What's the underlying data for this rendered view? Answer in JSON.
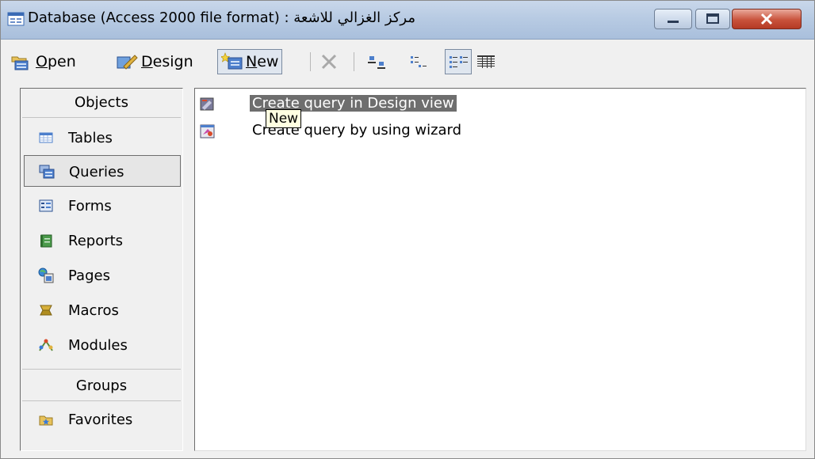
{
  "window": {
    "title": "مركز الغزالي للاشعة : Database (Access 2000 file format)",
    "accent": "#b8cbe3",
    "close_color": "#c9523b"
  },
  "toolbar": {
    "open_label": "Open",
    "open_mnemonic": "O",
    "design_label": "Design",
    "design_mnemonic": "D",
    "new_label": "New",
    "new_mnemonic": "N",
    "icons": [
      "open-icon",
      "design-icon",
      "new-icon",
      "delete-icon",
      "large-icons-view-icon",
      "small-icons-view-icon",
      "list-view-icon",
      "details-view-icon"
    ]
  },
  "sidebar": {
    "objects_header": "Objects",
    "groups_header": "Groups",
    "items": [
      {
        "label": "Tables",
        "icon": "table-icon"
      },
      {
        "label": "Queries",
        "icon": "query-icon"
      },
      {
        "label": "Forms",
        "icon": "form-icon"
      },
      {
        "label": "Reports",
        "icon": "report-icon"
      },
      {
        "label": "Pages",
        "icon": "page-icon"
      },
      {
        "label": "Macros",
        "icon": "macro-icon"
      },
      {
        "label": "Modules",
        "icon": "module-icon"
      }
    ],
    "selected": "Queries",
    "groups": [
      {
        "label": "Favorites",
        "icon": "favorites-icon"
      }
    ]
  },
  "main": {
    "shortcuts": [
      {
        "label": "Create query in Design view",
        "icon": "design-view-query-icon"
      },
      {
        "label": "Create query by using wizard",
        "icon": "wizard-query-icon"
      }
    ],
    "tooltip": "New"
  }
}
